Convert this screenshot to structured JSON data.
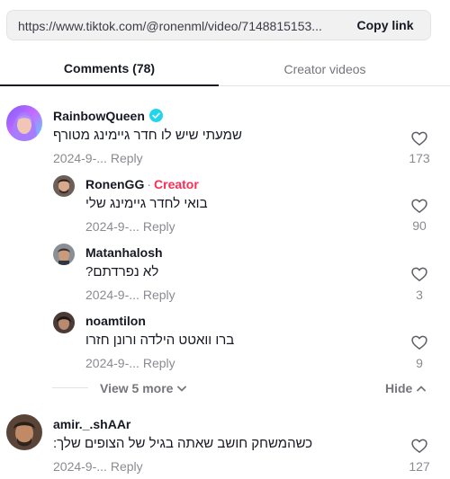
{
  "share": {
    "url": "https://www.tiktok.com/@ronenml/video/7148815153...",
    "copy_label": "Copy link"
  },
  "tabs": [
    {
      "label": "Comments (78)",
      "active": true
    },
    {
      "label": "Creator videos",
      "active": false
    }
  ],
  "comments": [
    {
      "username": "RainbowQueen",
      "verified": true,
      "text": "שמעתי שיש לו חדר גיימינג מטורף",
      "date": "2024-9-...",
      "reply_label": "Reply",
      "likes": "173",
      "avatar_icon": "avatar-rainbowqueen"
    }
  ],
  "replies": [
    {
      "username": "RonenGG",
      "creator_label": "Creator",
      "text": "בואי לחדר גיימינג שלי",
      "date": "2024-9-...",
      "reply_label": "Reply",
      "likes": "90"
    },
    {
      "username": "Matanhalosh",
      "text": "לא נפרדתם?",
      "date": "2024-9-...",
      "reply_label": "Reply",
      "likes": "3"
    },
    {
      "username": "noamtilon",
      "text": "ברו וואטט הילדה ורונן חזרו",
      "date": "2024-9-...",
      "reply_label": "Reply",
      "likes": "9"
    }
  ],
  "thread_controls": {
    "view_more_label": "View 5 more",
    "hide_label": "Hide"
  },
  "last_comment": {
    "username": "amir._.shAAr",
    "text": "כשהמשחק חושב שאתה בגיל של הצופים שלך:",
    "date": "2024-9-...",
    "reply_label": "Reply",
    "likes": "127"
  },
  "colors": {
    "creator": "#fe2c55",
    "verified": "#20d5ec",
    "muted": "#8a8b91"
  }
}
